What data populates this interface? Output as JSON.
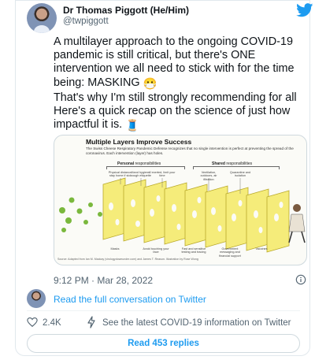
{
  "author": {
    "name": "Dr Thomas Piggott (He/Him)",
    "handle": "@twpiggott"
  },
  "tweet": {
    "paragraph_1": "A multilayer approach to the ongoing COVID-19 pandemic is still critical, but there's ONE intervention we all need to stick with for the time being: MASKING",
    "paragraph_2": "That's why I'm still strongly recommending for all Here's a quick recap on the science of just how impactful it is.",
    "emoji_1": "😷",
    "emoji_2": "🧵"
  },
  "infographic": {
    "title": "Multiple Layers Improve Success",
    "subtitle": "The Swiss Cheese Respiratory Pandemic Defense recognizes that no single intervention is perfect at preventing the spread of the coronavirus. Each intervention (layer) has holes.",
    "personal_label": "Personal",
    "personal_rest": "responsibilities",
    "shared_label": "Shared",
    "shared_rest": "responsibilities",
    "top_labels": [
      "Physical distance, stay home if sick",
      "Hand hygiene, cough etiquette",
      "If exerted, limit your time",
      "Ventilation, outdoors, air filtration",
      "Quarantine and isolation"
    ],
    "bottom_labels": [
      "Masks",
      "Avoid touching your face",
      "Fast and sensitive testing and tracing",
      "Government messaging and financial support",
      "Vaccines"
    ],
    "source": "Source: Adapted from Ian M. Mackay (virologydownunder.com) and James T. Reason. Illustration by Rose Wong",
    "colors": {
      "cheese": "#f5ec7a",
      "cheese_edge": "#b9a92a",
      "virus": "#7ab83d"
    }
  },
  "meta": {
    "timestamp": "9:12 PM · Mar 28, 2022",
    "read_conversation": "Read the full conversation on Twitter",
    "like_count": "2.4K",
    "covid_info": "See the latest COVID-19 information on Twitter",
    "read_replies": "Read 453 replies"
  },
  "colors": {
    "link": "#1d9bf0",
    "muted": "#536471",
    "twitter_blue": "#1d9bf0"
  }
}
